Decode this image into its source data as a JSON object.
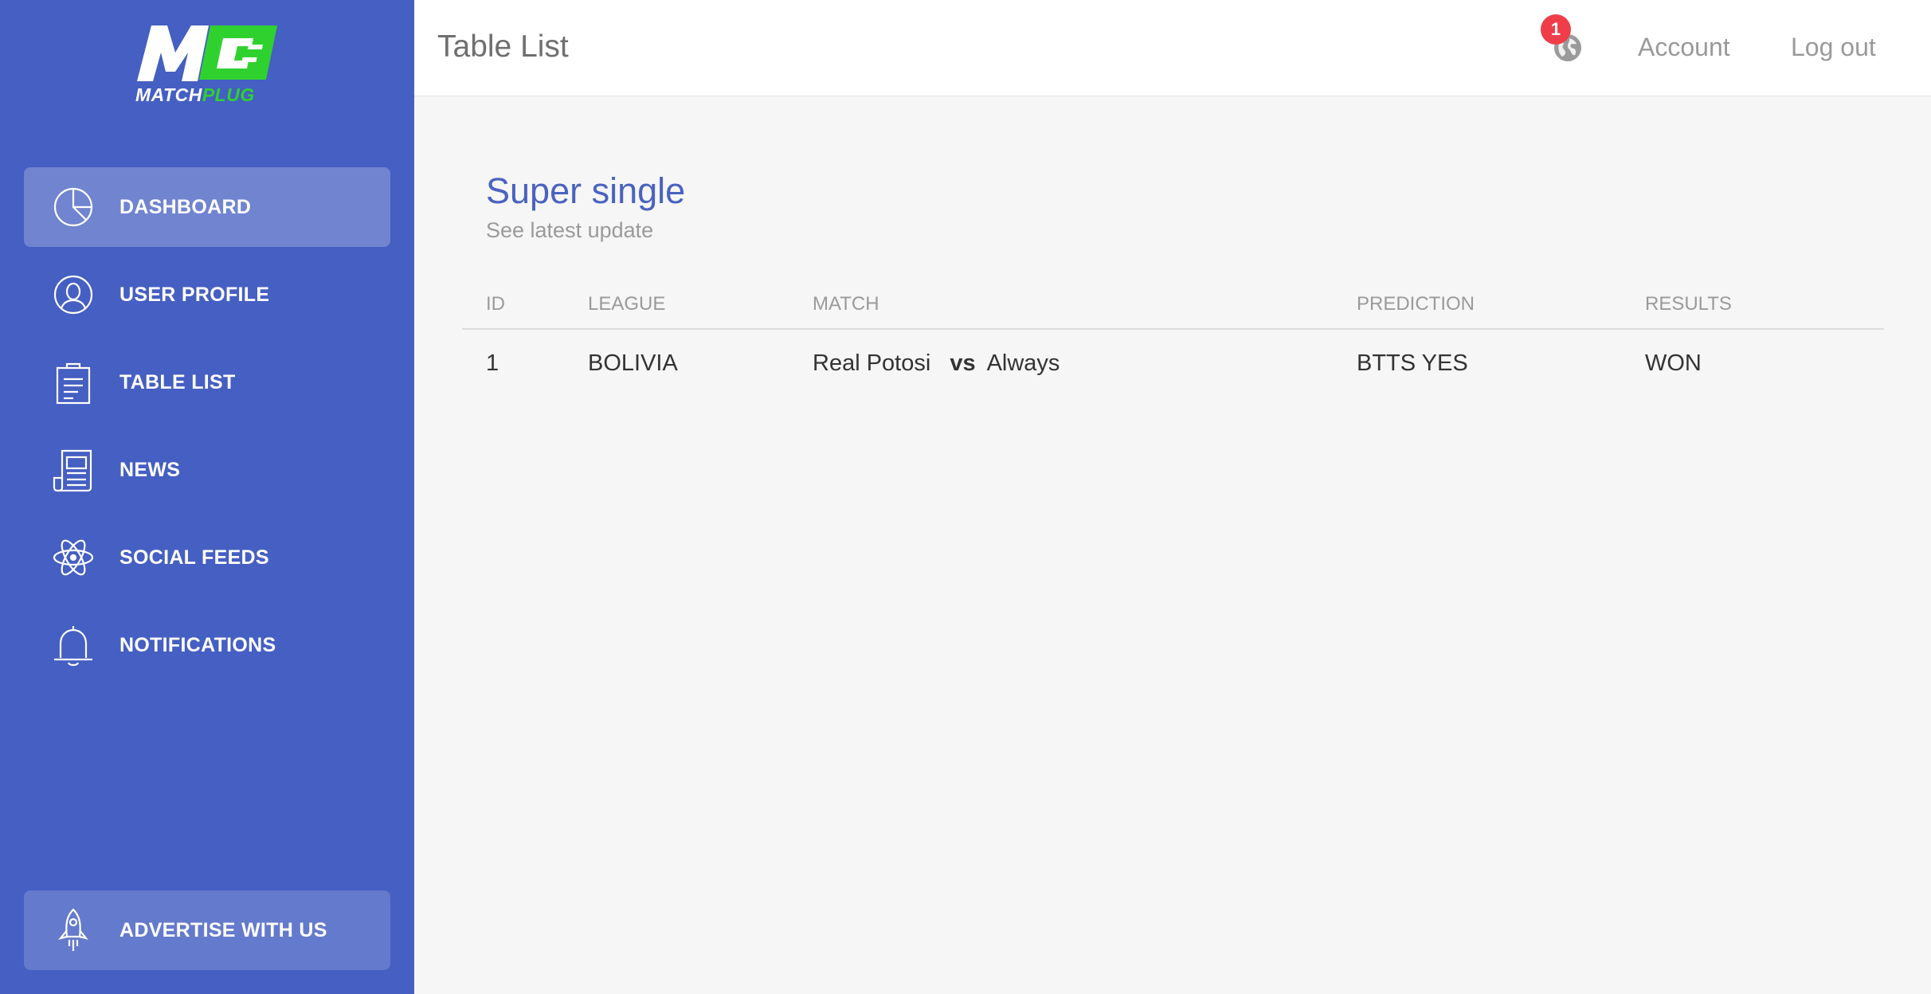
{
  "brand": {
    "logo_text_white": "MATCH",
    "logo_text_green": "PLUG",
    "colors": {
      "sidebar": "#455fc2",
      "logo_green": "#2fd12f",
      "title_blue": "#4a63c0",
      "badge_red": "#ef3e4a"
    }
  },
  "sidebar": {
    "items": [
      {
        "label": "DASHBOARD",
        "icon": "pie-chart-icon",
        "active": true
      },
      {
        "label": "USER PROFILE",
        "icon": "user-icon",
        "active": false
      },
      {
        "label": "TABLE LIST",
        "icon": "clipboard-icon",
        "active": false
      },
      {
        "label": "NEWS",
        "icon": "newspaper-icon",
        "active": false
      },
      {
        "label": "SOCIAL FEEDS",
        "icon": "atom-icon",
        "active": false
      },
      {
        "label": "NOTIFICATIONS",
        "icon": "bell-icon",
        "active": false
      }
    ],
    "advertise_label": "ADVERTISE WITH US",
    "advertise_icon": "rocket-icon"
  },
  "header": {
    "title": "Table List",
    "notification_count": "1",
    "globe_icon": "globe-icon",
    "account_label": "Account",
    "logout_label": "Log out"
  },
  "card": {
    "title": "Super single",
    "subtitle": "See latest update",
    "columns": [
      "ID",
      "LEAGUE",
      "MATCH",
      "PREDICTION",
      "RESULTS"
    ],
    "rows": [
      {
        "id": "1",
        "league": "BOLIVIA",
        "home": "Real Potosi",
        "vs": "vs",
        "away": "Always",
        "prediction": "BTTS YES",
        "result": "WON"
      }
    ]
  }
}
